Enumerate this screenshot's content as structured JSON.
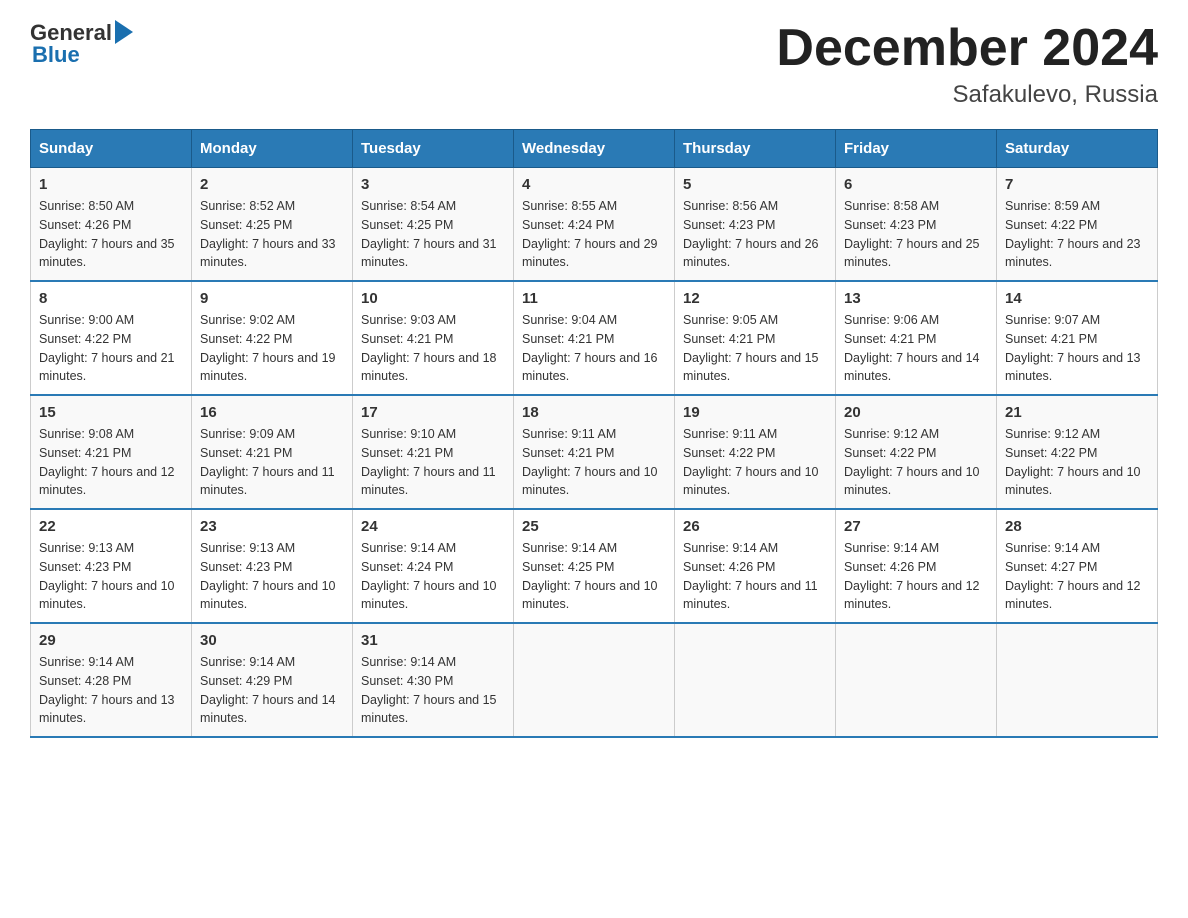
{
  "header": {
    "month_title": "December 2024",
    "location": "Safakulevo, Russia",
    "logo_general": "General",
    "logo_blue": "Blue"
  },
  "weekdays": [
    "Sunday",
    "Monday",
    "Tuesday",
    "Wednesday",
    "Thursday",
    "Friday",
    "Saturday"
  ],
  "weeks": [
    [
      {
        "day": "1",
        "sunrise": "8:50 AM",
        "sunset": "4:26 PM",
        "daylight": "7 hours and 35 minutes."
      },
      {
        "day": "2",
        "sunrise": "8:52 AM",
        "sunset": "4:25 PM",
        "daylight": "7 hours and 33 minutes."
      },
      {
        "day": "3",
        "sunrise": "8:54 AM",
        "sunset": "4:25 PM",
        "daylight": "7 hours and 31 minutes."
      },
      {
        "day": "4",
        "sunrise": "8:55 AM",
        "sunset": "4:24 PM",
        "daylight": "7 hours and 29 minutes."
      },
      {
        "day": "5",
        "sunrise": "8:56 AM",
        "sunset": "4:23 PM",
        "daylight": "7 hours and 26 minutes."
      },
      {
        "day": "6",
        "sunrise": "8:58 AM",
        "sunset": "4:23 PM",
        "daylight": "7 hours and 25 minutes."
      },
      {
        "day": "7",
        "sunrise": "8:59 AM",
        "sunset": "4:22 PM",
        "daylight": "7 hours and 23 minutes."
      }
    ],
    [
      {
        "day": "8",
        "sunrise": "9:00 AM",
        "sunset": "4:22 PM",
        "daylight": "7 hours and 21 minutes."
      },
      {
        "day": "9",
        "sunrise": "9:02 AM",
        "sunset": "4:22 PM",
        "daylight": "7 hours and 19 minutes."
      },
      {
        "day": "10",
        "sunrise": "9:03 AM",
        "sunset": "4:21 PM",
        "daylight": "7 hours and 18 minutes."
      },
      {
        "day": "11",
        "sunrise": "9:04 AM",
        "sunset": "4:21 PM",
        "daylight": "7 hours and 16 minutes."
      },
      {
        "day": "12",
        "sunrise": "9:05 AM",
        "sunset": "4:21 PM",
        "daylight": "7 hours and 15 minutes."
      },
      {
        "day": "13",
        "sunrise": "9:06 AM",
        "sunset": "4:21 PM",
        "daylight": "7 hours and 14 minutes."
      },
      {
        "day": "14",
        "sunrise": "9:07 AM",
        "sunset": "4:21 PM",
        "daylight": "7 hours and 13 minutes."
      }
    ],
    [
      {
        "day": "15",
        "sunrise": "9:08 AM",
        "sunset": "4:21 PM",
        "daylight": "7 hours and 12 minutes."
      },
      {
        "day": "16",
        "sunrise": "9:09 AM",
        "sunset": "4:21 PM",
        "daylight": "7 hours and 11 minutes."
      },
      {
        "day": "17",
        "sunrise": "9:10 AM",
        "sunset": "4:21 PM",
        "daylight": "7 hours and 11 minutes."
      },
      {
        "day": "18",
        "sunrise": "9:11 AM",
        "sunset": "4:21 PM",
        "daylight": "7 hours and 10 minutes."
      },
      {
        "day": "19",
        "sunrise": "9:11 AM",
        "sunset": "4:22 PM",
        "daylight": "7 hours and 10 minutes."
      },
      {
        "day": "20",
        "sunrise": "9:12 AM",
        "sunset": "4:22 PM",
        "daylight": "7 hours and 10 minutes."
      },
      {
        "day": "21",
        "sunrise": "9:12 AM",
        "sunset": "4:22 PM",
        "daylight": "7 hours and 10 minutes."
      }
    ],
    [
      {
        "day": "22",
        "sunrise": "9:13 AM",
        "sunset": "4:23 PM",
        "daylight": "7 hours and 10 minutes."
      },
      {
        "day": "23",
        "sunrise": "9:13 AM",
        "sunset": "4:23 PM",
        "daylight": "7 hours and 10 minutes."
      },
      {
        "day": "24",
        "sunrise": "9:14 AM",
        "sunset": "4:24 PM",
        "daylight": "7 hours and 10 minutes."
      },
      {
        "day": "25",
        "sunrise": "9:14 AM",
        "sunset": "4:25 PM",
        "daylight": "7 hours and 10 minutes."
      },
      {
        "day": "26",
        "sunrise": "9:14 AM",
        "sunset": "4:26 PM",
        "daylight": "7 hours and 11 minutes."
      },
      {
        "day": "27",
        "sunrise": "9:14 AM",
        "sunset": "4:26 PM",
        "daylight": "7 hours and 12 minutes."
      },
      {
        "day": "28",
        "sunrise": "9:14 AM",
        "sunset": "4:27 PM",
        "daylight": "7 hours and 12 minutes."
      }
    ],
    [
      {
        "day": "29",
        "sunrise": "9:14 AM",
        "sunset": "4:28 PM",
        "daylight": "7 hours and 13 minutes."
      },
      {
        "day": "30",
        "sunrise": "9:14 AM",
        "sunset": "4:29 PM",
        "daylight": "7 hours and 14 minutes."
      },
      {
        "day": "31",
        "sunrise": "9:14 AM",
        "sunset": "4:30 PM",
        "daylight": "7 hours and 15 minutes."
      },
      null,
      null,
      null,
      null
    ]
  ]
}
